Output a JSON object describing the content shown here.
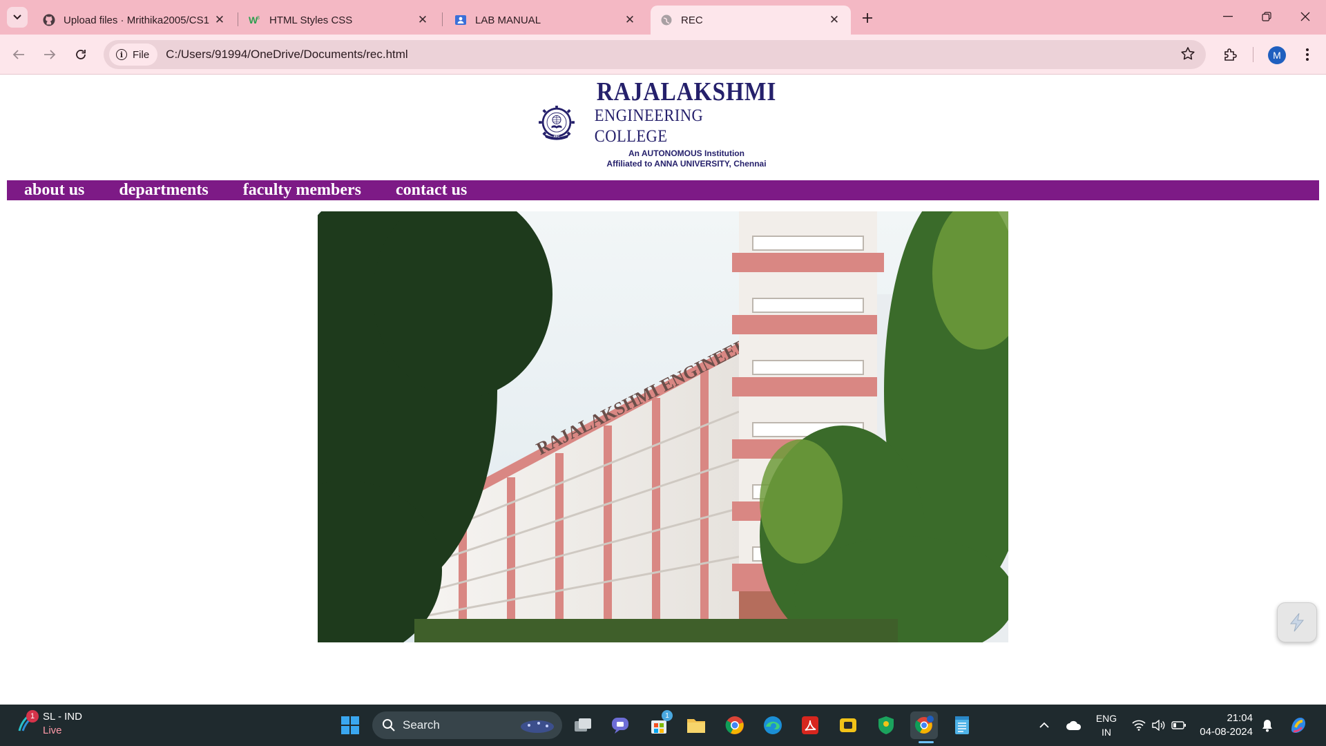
{
  "browser": {
    "tabs": [
      {
        "title": "Upload files · Mrithika2005/CS1",
        "icon": "github-icon"
      },
      {
        "title": "HTML Styles CSS",
        "icon": "w3schools-icon"
      },
      {
        "title": "LAB MANUAL",
        "icon": "google-sites-icon"
      },
      {
        "title": "REC",
        "icon": "globe-icon",
        "active": true
      }
    ],
    "address": {
      "chip_label": "File",
      "url": "C:/Users/91994/OneDrive/Documents/rec.html"
    },
    "profile_initial": "M",
    "colors": {
      "tabbar": "#f4b8c4",
      "toolbar": "#fde6eb"
    }
  },
  "site": {
    "logo": {
      "line1": "RAJALAKSHMI",
      "line2": "ENGINEERING COLLEGE",
      "line3": "An AUTONOMOUS Institution",
      "line4": "Affiliated to ANNA UNIVERSITY, Chennai",
      "seal_text": "REC"
    },
    "nav": [
      "about us",
      "departments",
      "faculty members",
      "contact us"
    ],
    "hero_sign": "RAJALAKSHMI ENGINEERING COLLEGE",
    "colors": {
      "nav_bg": "#7d1a86",
      "logo_text": "#25206b"
    }
  },
  "taskbar": {
    "weather_title": "SL - IND",
    "weather_status": "Live",
    "weather_badge": "1",
    "search_placeholder": "Search",
    "store_badge": "1",
    "lang_line1": "ENG",
    "lang_line2": "IN",
    "time": "21:04",
    "date": "04-08-2024"
  }
}
